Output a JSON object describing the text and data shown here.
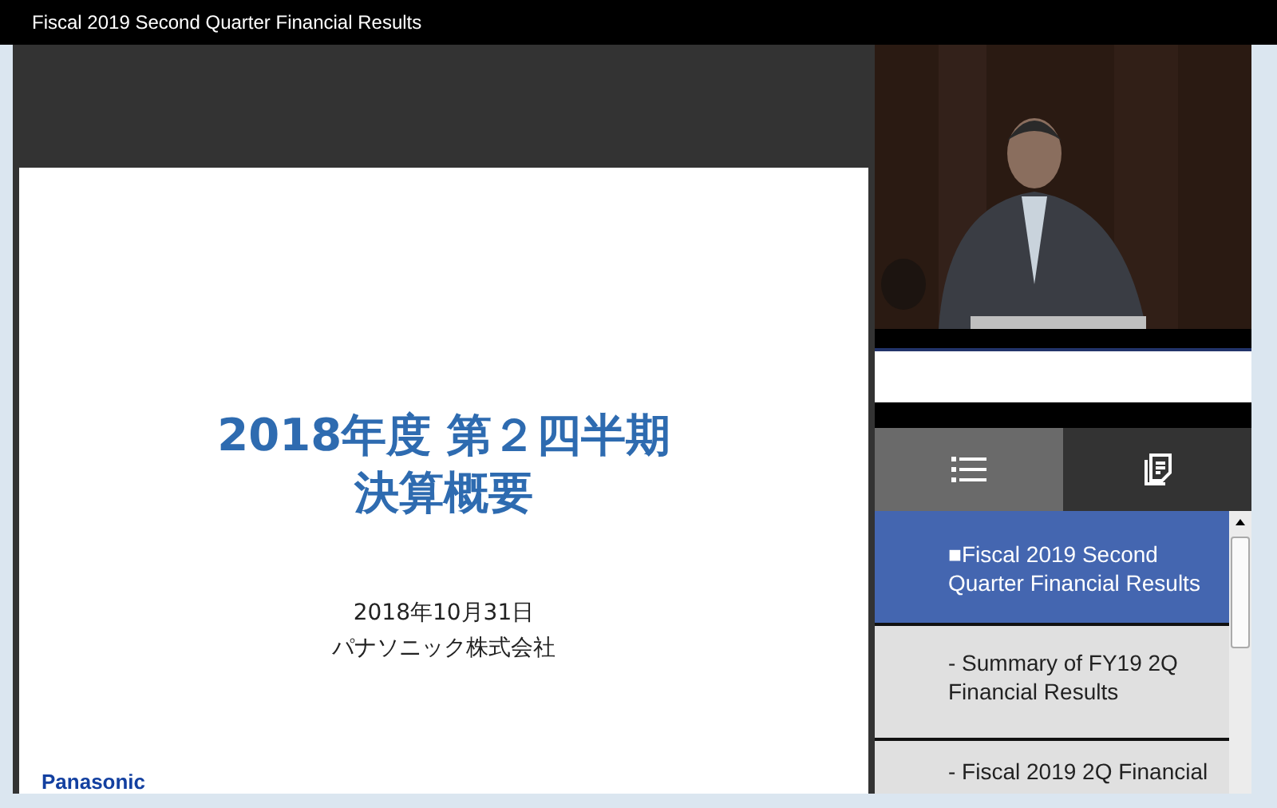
{
  "window": {
    "title": "Fiscal 2019 Second Quarter Financial Results"
  },
  "slide": {
    "title_lines": [
      "2018年度 第２四半期",
      "決算概要"
    ],
    "date": "2018年10月31日",
    "company": "パナソニック株式会社",
    "logo": "Panasonic"
  },
  "tabs": [
    {
      "kind": "list",
      "selected": true
    },
    {
      "kind": "notes",
      "selected": false
    }
  ],
  "chapters": [
    {
      "label": "■Fiscal 2019 Second Quarter Financial Results",
      "selected": true
    },
    {
      "label": "- Summary of FY19 2Q Financial Results",
      "selected": false
    },
    {
      "label": "- Fiscal 2019 2Q Financial",
      "selected": false
    }
  ]
}
